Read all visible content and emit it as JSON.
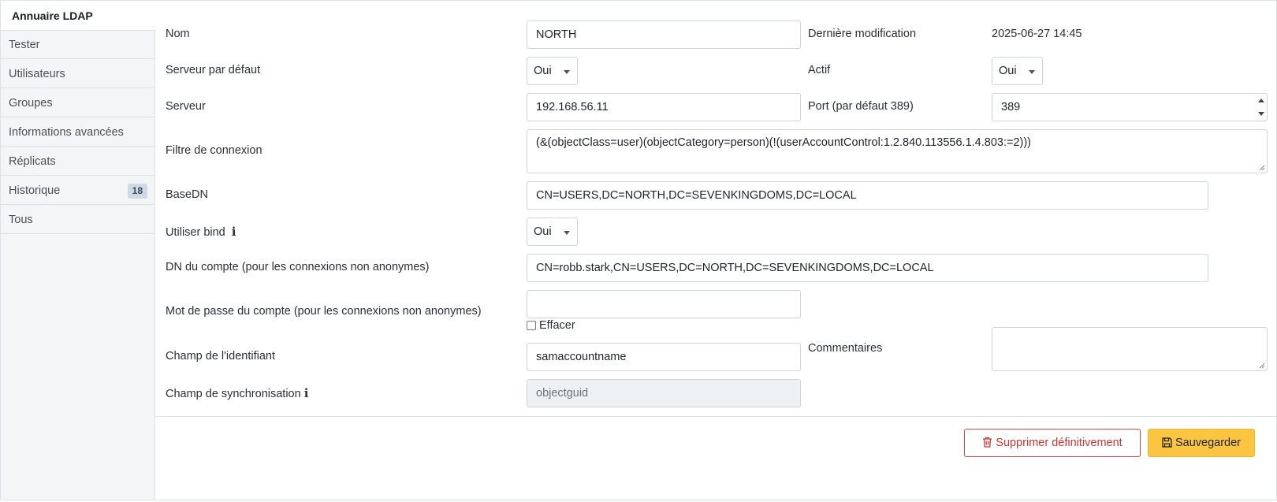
{
  "sidebar": {
    "items": [
      {
        "label": "Annuaire LDAP",
        "active": true
      },
      {
        "label": "Tester"
      },
      {
        "label": "Utilisateurs"
      },
      {
        "label": "Groupes"
      },
      {
        "label": "Informations avancées"
      },
      {
        "label": "Réplicats"
      },
      {
        "label": "Historique",
        "badge": "18"
      },
      {
        "label": "Tous"
      }
    ]
  },
  "form": {
    "name": {
      "label": "Nom",
      "value": "NORTH"
    },
    "last_modified": {
      "label": "Dernière modification",
      "value": "2025-06-27 14:45"
    },
    "default_server": {
      "label": "Serveur par défaut",
      "value": "Oui"
    },
    "active": {
      "label": "Actif",
      "value": "Oui"
    },
    "server": {
      "label": "Serveur",
      "value": "192.168.56.11"
    },
    "port": {
      "label": "Port (par défaut 389)",
      "value": "389"
    },
    "connection_filter": {
      "label": "Filtre de connexion",
      "value": "(&(objectClass=user)(objectCategory=person)(!(userAccountControl:1.2.840.113556.1.4.803:=2)))"
    },
    "basedn": {
      "label": "BaseDN",
      "value": "CN=USERS,DC=NORTH,DC=SEVENKINGDOMS,DC=LOCAL"
    },
    "use_bind": {
      "label": "Utiliser bind",
      "value": "Oui"
    },
    "account_dn": {
      "label": "DN du compte (pour les connexions non anonymes)",
      "value": "CN=robb.stark,CN=USERS,DC=NORTH,DC=SEVENKINGDOMS,DC=LOCAL"
    },
    "account_password": {
      "label": "Mot de passe du compte (pour les connexions non anonymes)",
      "value": "",
      "clear_label": "Effacer",
      "clear_checked": false
    },
    "login_field": {
      "label": "Champ de l'identifiant",
      "value": "samaccountname"
    },
    "comments": {
      "label": "Commentaires",
      "value": ""
    },
    "sync_field": {
      "label": "Champ de synchronisation",
      "value": "objectguid",
      "disabled": true
    }
  },
  "actions": {
    "delete_label": "Supprimer définitivement",
    "save_label": "Sauvegarder"
  },
  "colors": {
    "danger": "#c93636",
    "warning": "#fbc542",
    "sidebar_bg": "#f4f5f7"
  },
  "icons": {
    "info": "info-icon",
    "trash": "trash-icon",
    "save": "floppy-icon"
  }
}
